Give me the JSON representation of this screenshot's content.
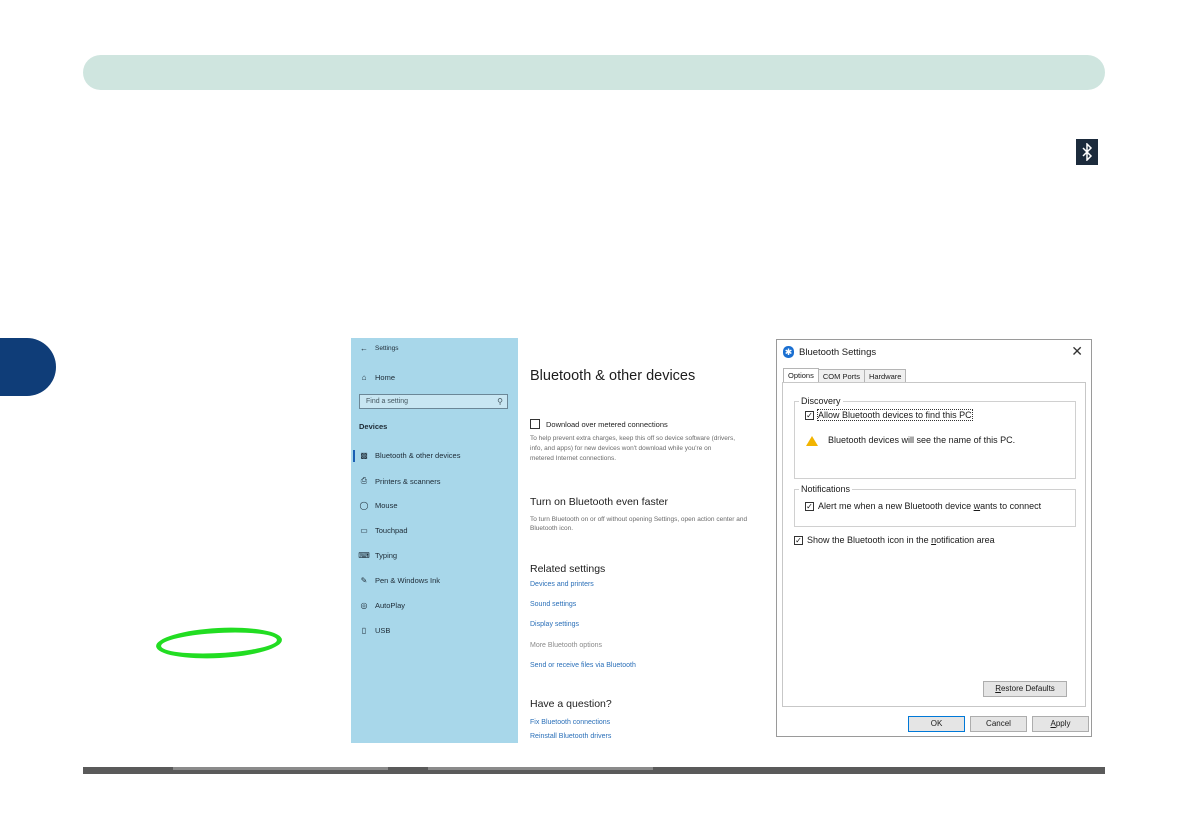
{
  "page": {
    "accent": "#0f3d78",
    "header_bg": "#cfe5df"
  },
  "icons": {
    "tray": "bluetooth-icon"
  },
  "settings": {
    "window_title": "Settings",
    "home": "Home",
    "search_placeholder": "Find a setting",
    "category": "Devices",
    "nav": [
      {
        "label": "Bluetooth & other devices",
        "icon": "bluetooth-icon"
      },
      {
        "label": "Printers & scanners",
        "icon": "printer-icon"
      },
      {
        "label": "Mouse",
        "icon": "mouse-icon"
      },
      {
        "label": "Touchpad",
        "icon": "touchpad-icon"
      },
      {
        "label": "Typing",
        "icon": "keyboard-icon"
      },
      {
        "label": "Pen & Windows Ink",
        "icon": "pen-icon"
      },
      {
        "label": "AutoPlay",
        "icon": "autoplay-icon"
      },
      {
        "label": "USB",
        "icon": "usb-icon"
      }
    ],
    "page_title": "Bluetooth & other devices",
    "metered_label": "Download over metered connections",
    "metered_desc": [
      "To help prevent extra charges, keep this off so device software (drivers,",
      "info, and apps) for new devices won't download while you're on",
      "metered Internet connections."
    ],
    "faster_title": "Turn on Bluetooth even faster",
    "faster_desc": [
      "To turn Bluetooth on or off without opening Settings, open action center and",
      "Bluetooth icon."
    ],
    "related_title": "Related settings",
    "related_links": [
      "Devices and printers",
      "Sound settings",
      "Display settings",
      "More Bluetooth options",
      "Send or receive files via Bluetooth"
    ],
    "question_title": "Have a question?",
    "question_links": [
      "Fix Bluetooth connections",
      "Reinstall Bluetooth drivers"
    ]
  },
  "dialog": {
    "title": "Bluetooth Settings",
    "tabs": [
      "Options",
      "COM Ports",
      "Hardware"
    ],
    "discovery": {
      "legend": "Discovery",
      "allow_label": "Allow Bluetooth devices to find this PC",
      "allow_checked": true,
      "warning": "Bluetooth devices will see the name of this PC."
    },
    "notifications": {
      "legend": "Notifications",
      "alert_pre": "Alert me when a new Bluetooth device ",
      "alert_u": "w",
      "alert_post": "ants to connect",
      "alert_checked": true
    },
    "show_icon_pre": "Show the Bluetooth icon in the ",
    "show_icon_u": "n",
    "show_icon_post": "otification area",
    "show_icon_checked": true,
    "restore_u": "R",
    "restore_rest": "estore Defaults",
    "ok": "OK",
    "cancel": "Cancel",
    "apply_u": "A",
    "apply_rest": "pply"
  }
}
